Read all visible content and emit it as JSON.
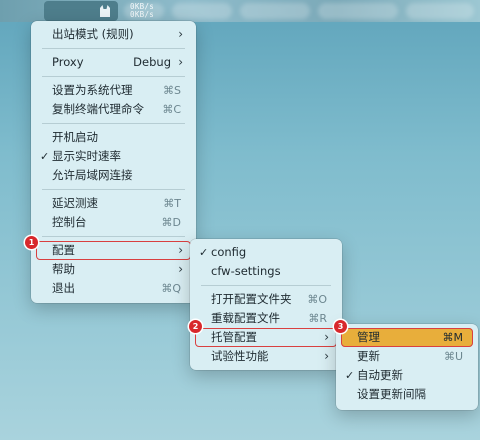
{
  "menubar": {
    "speed_up": "0KB/s",
    "speed_down": "0KB/s"
  },
  "main_menu": {
    "items": [
      {
        "label": "出站模式 (规则)",
        "submenu": true
      },
      {
        "label": "Proxy",
        "value": "Debug",
        "submenu": true
      },
      {
        "label": "设置为系统代理",
        "shortcut": "⌘S"
      },
      {
        "label": "复制终端代理命令",
        "shortcut": "⌘C"
      },
      {
        "label": "开机启动"
      },
      {
        "label": "显示实时速率",
        "checked": true
      },
      {
        "label": "允许局域网连接"
      },
      {
        "label": "延迟测速",
        "shortcut": "⌘T"
      },
      {
        "label": "控制台",
        "shortcut": "⌘D"
      },
      {
        "label": "配置",
        "submenu": true
      },
      {
        "label": "帮助",
        "submenu": true
      },
      {
        "label": "退出",
        "shortcut": "⌘Q"
      }
    ]
  },
  "config_menu": {
    "items": [
      {
        "label": "config",
        "checked": true
      },
      {
        "label": "cfw-settings"
      },
      {
        "label": "打开配置文件夹",
        "shortcut": "⌘O"
      },
      {
        "label": "重载配置文件",
        "shortcut": "⌘R"
      },
      {
        "label": "托管配置",
        "submenu": true
      },
      {
        "label": "试验性功能",
        "submenu": true
      }
    ]
  },
  "managed_menu": {
    "items": [
      {
        "label": "管理",
        "shortcut": "⌘M"
      },
      {
        "label": "更新",
        "shortcut": "⌘U"
      },
      {
        "label": "自动更新",
        "checked": true
      },
      {
        "label": "设置更新间隔"
      }
    ]
  },
  "badges": [
    "1",
    "2",
    "3"
  ],
  "glyphs": {
    "check": "✓",
    "chevron": "›"
  },
  "colors": {
    "highlight": "#e8ae3b",
    "outline": "#d94040",
    "badge": "#d8282c"
  }
}
